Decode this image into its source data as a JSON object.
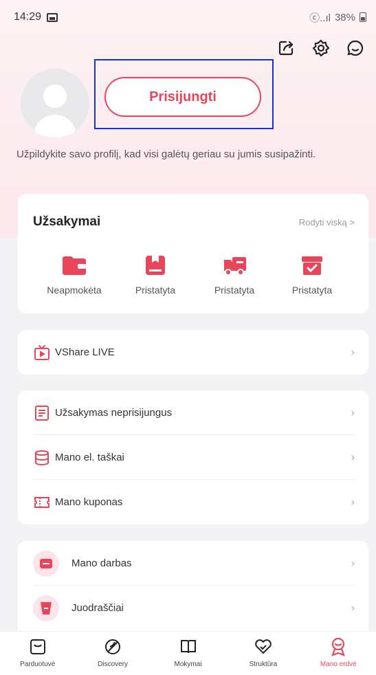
{
  "status_bar": {
    "time": "14:29",
    "signal": "ⓒ..ıl",
    "battery": "38%"
  },
  "top_actions": [
    "share-icon",
    "settings-icon",
    "chat-icon"
  ],
  "profile": {
    "login_label": "Prisijungti",
    "hint": "Užpildykite savo profilį, kad visi galėtų geriau su jumis susipažinti."
  },
  "orders": {
    "title": "Užsakymai",
    "see_all": "Rodyti viską >",
    "items": [
      {
        "label": "Neapmokėta",
        "icon": "wallet-icon"
      },
      {
        "label": "Pristatyta",
        "icon": "box-icon"
      },
      {
        "label": "Pristatyta",
        "icon": "truck-icon"
      },
      {
        "label": "Pristatyta",
        "icon": "package-check-icon"
      }
    ]
  },
  "vshare": {
    "label": "VShare LIVE"
  },
  "menu": [
    {
      "label": "Užsakymas neprisijungus",
      "icon": "document-icon"
    },
    {
      "label": "Mano el. taškai",
      "icon": "database-icon"
    },
    {
      "label": "Mano kuponas",
      "icon": "coupon-icon"
    }
  ],
  "menu2": [
    {
      "label": "Mano darbas",
      "icon": "work-icon"
    },
    {
      "label": "Juodraščiai",
      "icon": "drafts-icon"
    }
  ],
  "bottom_nav": [
    {
      "label": "Parduotuvė",
      "icon": "store-icon"
    },
    {
      "label": "Discovery",
      "icon": "discovery-icon"
    },
    {
      "label": "Mokymai",
      "icon": "book-icon"
    },
    {
      "label": "Struktūra",
      "icon": "heart-icon"
    },
    {
      "label": "Mano erdvė",
      "icon": "profile-badge-icon",
      "active": true
    }
  ],
  "colors": {
    "accent": "#e8455a",
    "highlight": "#1433d6"
  }
}
